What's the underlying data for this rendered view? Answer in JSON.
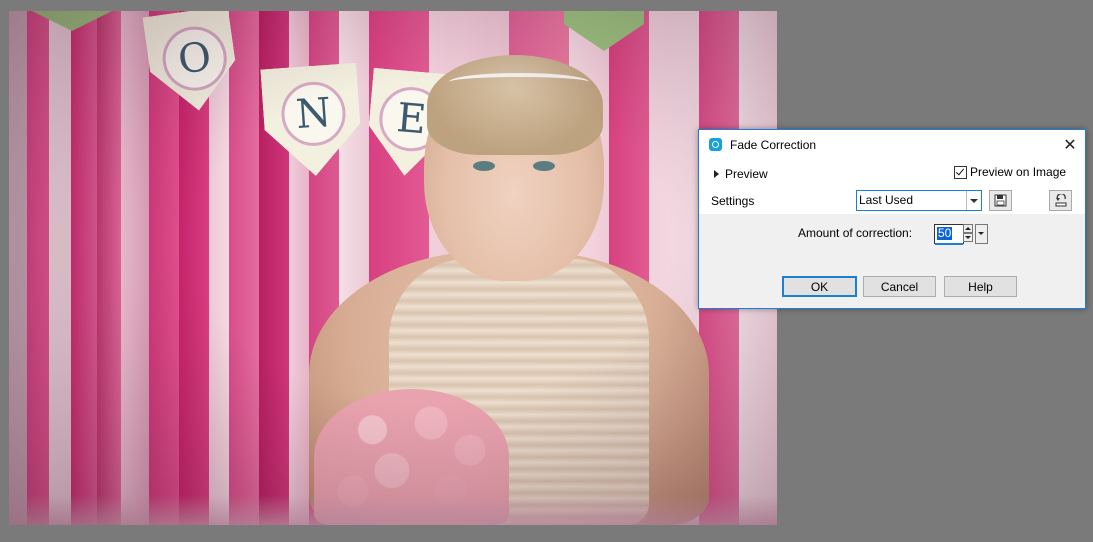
{
  "photo": {
    "banner_letters": [
      "O",
      "N",
      "E"
    ]
  },
  "dialog": {
    "title": "Fade Correction",
    "close_glyph": "✕",
    "preview_label": "Preview",
    "preview_on_image_label": "Preview on Image",
    "preview_on_image_checked": true,
    "settings_label": "Settings",
    "settings_value": "Last Used",
    "amount_label": "Amount of correction:",
    "amount_value": "50",
    "ok_label": "OK",
    "cancel_label": "Cancel",
    "help_label": "Help"
  },
  "colors": {
    "accent": "#1b80d4",
    "workspace_bg": "#7a7a7a",
    "app_icon": "#19a0d8"
  }
}
